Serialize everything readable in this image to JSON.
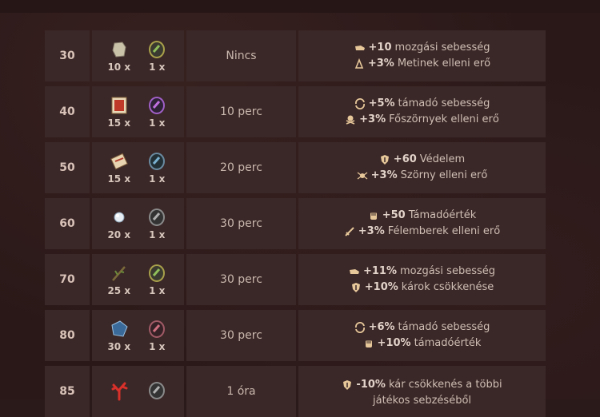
{
  "colors": {
    "background": "#2a1818",
    "cell": "#3a2727",
    "text": "#d9c9bf",
    "icon_gold": "#e6c79a"
  },
  "rows": [
    {
      "level": "30",
      "items": [
        {
          "icon": "stone-icon",
          "count": "10 x"
        },
        {
          "icon": "green-ore-icon",
          "count": "1 x"
        }
      ],
      "time": "Nincs",
      "bonuses": [
        {
          "icon": "boot-icon",
          "value": "+10",
          "text": "mozgási sebesség"
        },
        {
          "icon": "metin-icon",
          "value": "+3%",
          "text": "Metinek elleni erő"
        }
      ]
    },
    {
      "level": "40",
      "items": [
        {
          "icon": "book-icon",
          "count": "15 x"
        },
        {
          "icon": "purple-ore-icon",
          "count": "1 x"
        }
      ],
      "time": "10 perc",
      "bonuses": [
        {
          "icon": "speed-icon",
          "value": "+5%",
          "text": "támadó sebesség"
        },
        {
          "icon": "skull-icon",
          "value": "+3%",
          "text": "Főszörnyek elleni erő"
        }
      ]
    },
    {
      "level": "50",
      "items": [
        {
          "icon": "scroll-icon",
          "count": "15 x"
        },
        {
          "icon": "blue-ore-icon",
          "count": "1 x"
        }
      ],
      "time": "20 perc",
      "bonuses": [
        {
          "icon": "shield-icon",
          "value": "+60",
          "text": "Védelem"
        },
        {
          "icon": "spider-icon",
          "value": "+3%",
          "text": "Szörny elleni erő"
        }
      ]
    },
    {
      "level": "60",
      "items": [
        {
          "icon": "diamond-icon",
          "count": "20 x"
        },
        {
          "icon": "grey-ore-icon",
          "count": "1 x"
        }
      ],
      "time": "30 perc",
      "bonuses": [
        {
          "icon": "fist-icon",
          "value": "+50",
          "text": "Támadóérték"
        },
        {
          "icon": "sword-icon",
          "value": "+3%",
          "text": "Félemberek elleni erő"
        }
      ]
    },
    {
      "level": "70",
      "items": [
        {
          "icon": "branch-icon",
          "count": "25 x"
        },
        {
          "icon": "green-ore-icon",
          "count": "1 x"
        }
      ],
      "time": "30 perc",
      "bonuses": [
        {
          "icon": "boot-icon",
          "value": "+11%",
          "text": "mozgási sebesség"
        },
        {
          "icon": "shield-icon",
          "value": "+10%",
          "text": "károk csökkenése"
        }
      ]
    },
    {
      "level": "80",
      "items": [
        {
          "icon": "blue-crystal-icon",
          "count": "30 x"
        },
        {
          "icon": "red-ore-icon",
          "count": "1 x"
        }
      ],
      "time": "30 perc",
      "bonuses": [
        {
          "icon": "speed-icon",
          "value": "+6%",
          "text": "támadó sebesség"
        },
        {
          "icon": "fist-icon",
          "value": "+10%",
          "text": "támadóérték"
        }
      ]
    },
    {
      "level": "85",
      "items": [
        {
          "icon": "coral-icon",
          "count": ""
        },
        {
          "icon": "grey-ore-icon",
          "count": ""
        }
      ],
      "time": "1 óra",
      "bonuses": [
        {
          "icon": "shield-icon",
          "value": "-10%",
          "text": "kár csökkenés a többi"
        },
        {
          "icon": "",
          "value": "",
          "text": "játékos sebzéséből"
        }
      ]
    }
  ]
}
